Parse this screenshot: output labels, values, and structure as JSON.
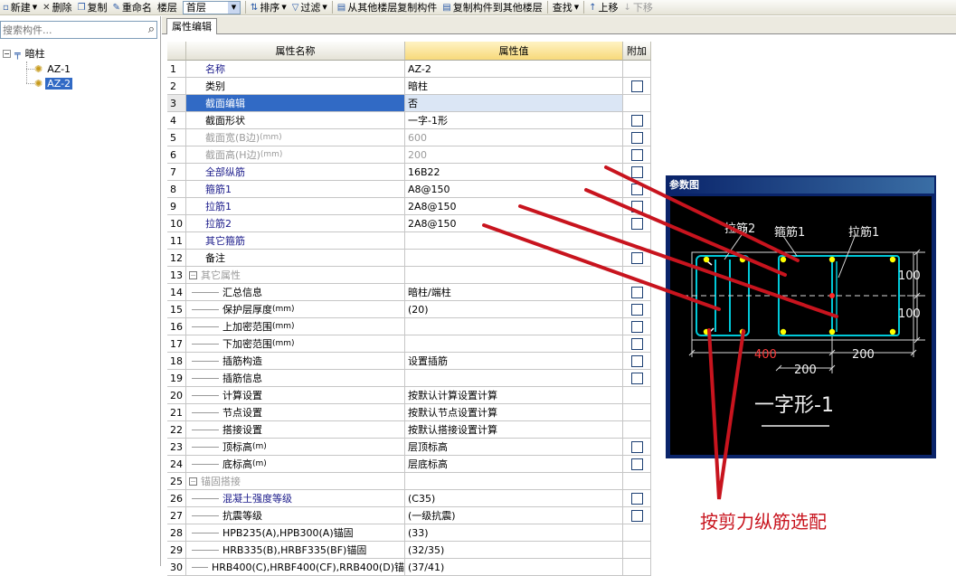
{
  "toolbar": {
    "new": "新建",
    "delete": "删除",
    "copy": "复制",
    "rename": "重命名",
    "floor_label": "楼层",
    "floor_value": "首层",
    "sort": "排序",
    "filter": "过滤",
    "copy_from_floor": "从其他楼层复制构件",
    "copy_to_floor": "复制构件到其他楼层",
    "find": "查找",
    "move_up": "上移",
    "move_down": "下移"
  },
  "tree": {
    "search_placeholder": "搜索构件...",
    "root": "暗柱",
    "items": [
      {
        "label": "AZ-1",
        "selected": false
      },
      {
        "label": "AZ-2",
        "selected": true
      }
    ]
  },
  "panel": {
    "tab": "属性编辑",
    "headers": {
      "name": "属性名称",
      "value": "属性值",
      "extra": "附加"
    }
  },
  "rows": [
    {
      "n": "1",
      "name": "名称",
      "value": "AZ-2",
      "style": "blue",
      "chk": false
    },
    {
      "n": "2",
      "name": "类别",
      "value": "暗柱",
      "style": "black",
      "chk": true
    },
    {
      "n": "3",
      "name": "截面编辑",
      "value": "否",
      "style": "blue",
      "chk": false,
      "selected": true
    },
    {
      "n": "4",
      "name": "截面形状",
      "value": "一字-1形",
      "style": "black",
      "chk": true
    },
    {
      "n": "5",
      "name": "截面宽(B边)",
      "unit": "(mm)",
      "value": "600",
      "style": "gray",
      "chk": true
    },
    {
      "n": "6",
      "name": "截面高(H边)",
      "unit": "(mm)",
      "value": "200",
      "style": "gray",
      "chk": true
    },
    {
      "n": "7",
      "name": "全部纵筋",
      "value": "16B22",
      "style": "blue",
      "chk": true
    },
    {
      "n": "8",
      "name": "箍筋1",
      "value": "A8@150",
      "style": "blue",
      "chk": true
    },
    {
      "n": "9",
      "name": "拉筋1",
      "value": "2A8@150",
      "style": "blue",
      "chk": true
    },
    {
      "n": "10",
      "name": "拉筋2",
      "value": "2A8@150",
      "style": "blue",
      "chk": true
    },
    {
      "n": "11",
      "name": "其它箍筋",
      "value": "",
      "style": "blue",
      "chk": false
    },
    {
      "n": "12",
      "name": "备注",
      "value": "",
      "style": "black",
      "chk": true
    },
    {
      "n": "13",
      "name": "其它属性",
      "value": "",
      "style": "group",
      "chk": false
    },
    {
      "n": "14",
      "name": "汇总信息",
      "value": "暗柱/端柱",
      "style": "child",
      "chk": true
    },
    {
      "n": "15",
      "name": "保护层厚度",
      "unit": "(mm)",
      "value": "(20)",
      "style": "child",
      "chk": true
    },
    {
      "n": "16",
      "name": "上加密范围",
      "unit": "(mm)",
      "value": "",
      "style": "child",
      "chk": true
    },
    {
      "n": "17",
      "name": "下加密范围",
      "unit": "(mm)",
      "value": "",
      "style": "child",
      "chk": true
    },
    {
      "n": "18",
      "name": "插筋构造",
      "value": "设置插筋",
      "style": "child",
      "chk": true
    },
    {
      "n": "19",
      "name": "插筋信息",
      "value": "",
      "style": "child",
      "chk": true
    },
    {
      "n": "20",
      "name": "计算设置",
      "value": "按默认计算设置计算",
      "style": "child",
      "chk": false
    },
    {
      "n": "21",
      "name": "节点设置",
      "value": "按默认节点设置计算",
      "style": "child",
      "chk": false
    },
    {
      "n": "22",
      "name": "搭接设置",
      "value": "按默认搭接设置计算",
      "style": "child",
      "chk": false
    },
    {
      "n": "23",
      "name": "顶标高",
      "unit": "(m)",
      "value": "层顶标高",
      "style": "child",
      "chk": true
    },
    {
      "n": "24",
      "name": "底标高",
      "unit": "(m)",
      "value": "层底标高",
      "style": "child",
      "chk": true
    },
    {
      "n": "25",
      "name": "锚固搭接",
      "value": "",
      "style": "group",
      "chk": false
    },
    {
      "n": "26",
      "name": "混凝土强度等级",
      "value": "(C35)",
      "style": "child-blue",
      "chk": true
    },
    {
      "n": "27",
      "name": "抗震等级",
      "value": "(一级抗震)",
      "style": "child",
      "chk": true
    },
    {
      "n": "28",
      "name": "HPB235(A),HPB300(A)锚固",
      "value": "(33)",
      "style": "child",
      "chk": false
    },
    {
      "n": "29",
      "name": "HRB335(B),HRBF335(BF)锚固",
      "value": "(32/35)",
      "style": "child",
      "chk": false
    },
    {
      "n": "30",
      "name": "HRB400(C),HRBF400(CF),RRB400(D)锚",
      "value": "(37/41)",
      "style": "child",
      "chk": false
    }
  ],
  "figure": {
    "title": "参数图",
    "labels": {
      "tie2": "拉筋2",
      "stirrup1": "箍筋1",
      "tie1": "拉筋1"
    },
    "dims": {
      "top": "100",
      "bottom": "100",
      "width_left": "400",
      "width_mid": "200",
      "width_right": "200"
    },
    "shape_name": "一字形-1"
  },
  "annotation": {
    "text": "按剪力纵筋选配",
    "color": "#c8141e"
  },
  "colors": {
    "selection": "#316ac5",
    "header_value": "#f7d97a",
    "figure_frame": "#0a246a",
    "rebar_cyan": "#00c8d8",
    "rebar_yellow": "#ffff00"
  }
}
